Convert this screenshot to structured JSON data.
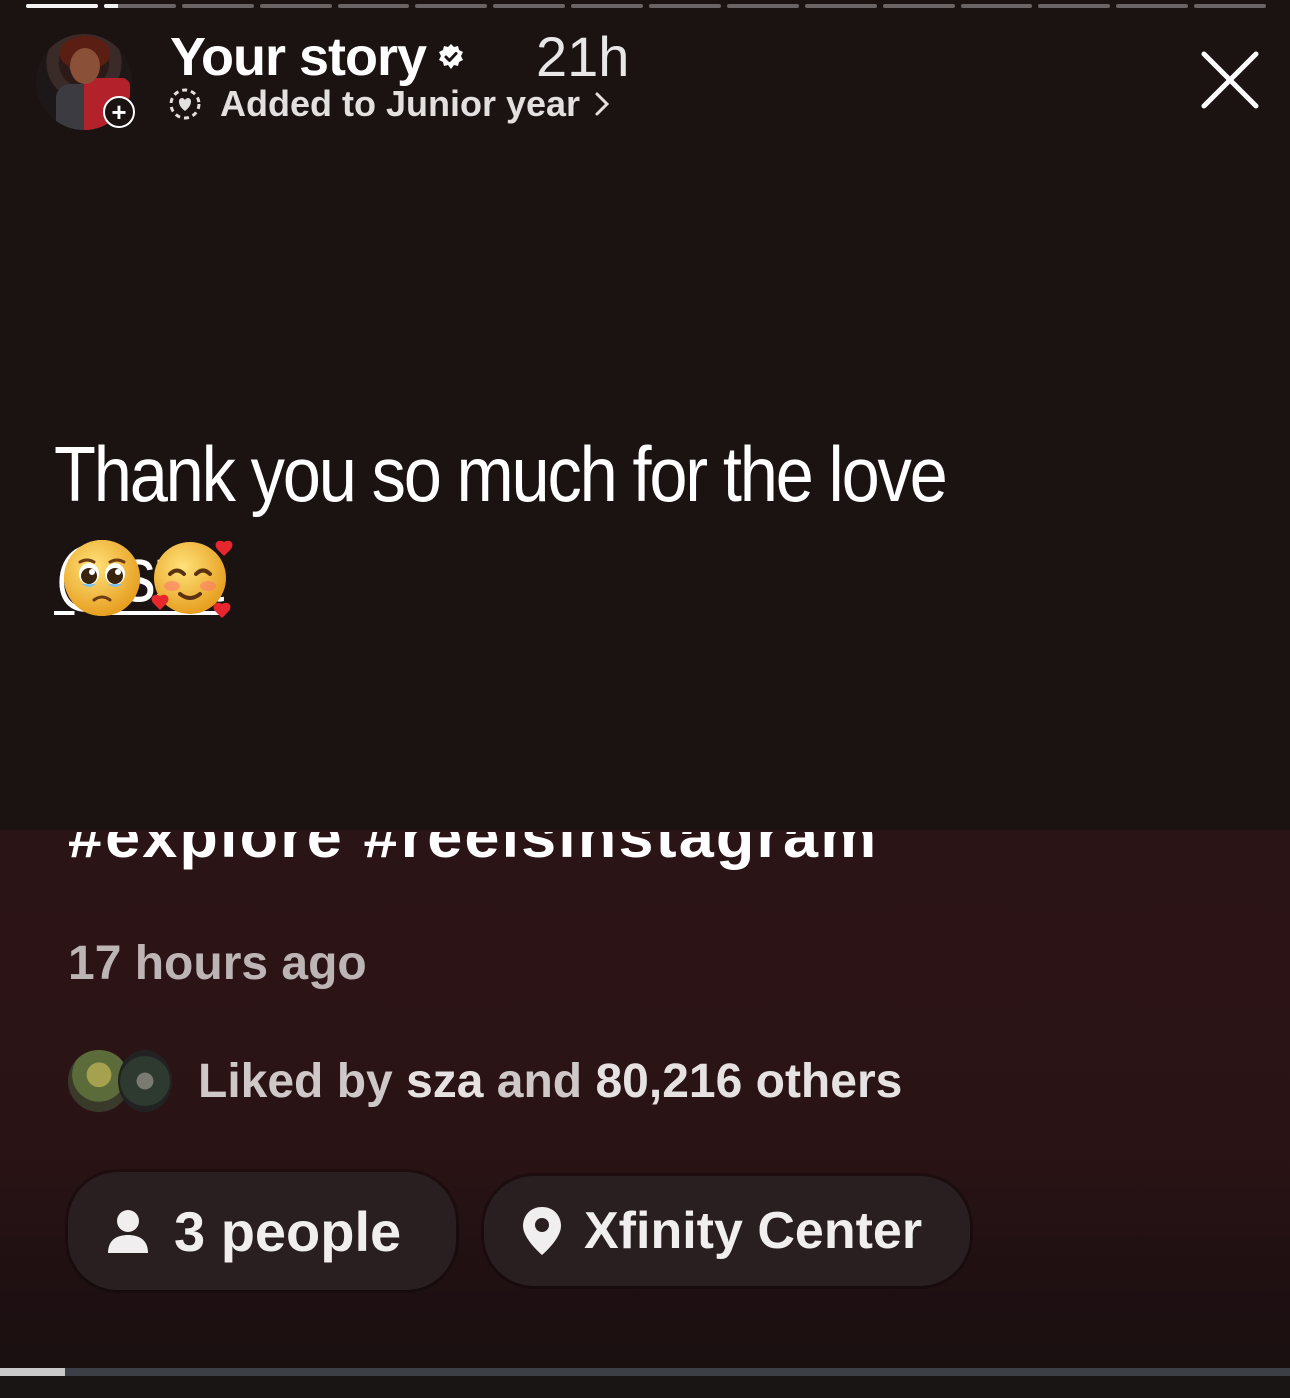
{
  "story": {
    "title": "Your story",
    "time": "21h",
    "highlight_label": "Added to Junior year",
    "segments_total": 16,
    "segments": [
      {
        "fill": 1.0
      },
      {
        "fill": 0.2
      },
      {
        "fill": 0
      },
      {
        "fill": 0
      },
      {
        "fill": 0
      },
      {
        "fill": 0
      },
      {
        "fill": 0
      },
      {
        "fill": 0
      },
      {
        "fill": 0
      },
      {
        "fill": 0
      },
      {
        "fill": 0
      },
      {
        "fill": 0
      },
      {
        "fill": 0
      },
      {
        "fill": 0
      },
      {
        "fill": 0
      },
      {
        "fill": 0
      }
    ],
    "message_text": "Thank you so much for the love ",
    "mention": "@sza",
    "emojis": [
      "pleading-face",
      "smiling-face-with-hearts"
    ]
  },
  "post": {
    "hashtags": "#explore #reelsinstagram",
    "time_ago": "17 hours ago",
    "liked_prefix": "Liked by ",
    "liked_user": "sza",
    "liked_mid": " and ",
    "liked_count": "80,216 others",
    "people_label": "3 people",
    "location_label": "Xfinity Center",
    "scrubber_progress": 0.05
  },
  "icons": {
    "verified": "verified-badge-icon",
    "highlight": "highlight-heart-icon",
    "chevron": "chevron-right-icon",
    "close": "close-icon",
    "person": "person-icon",
    "location": "location-pin-icon",
    "add": "add-icon"
  },
  "colors": {
    "background": "#1b1212",
    "post_background": "#2a1416",
    "text": "#ffffff",
    "muted_text": "#bdb5b5"
  }
}
